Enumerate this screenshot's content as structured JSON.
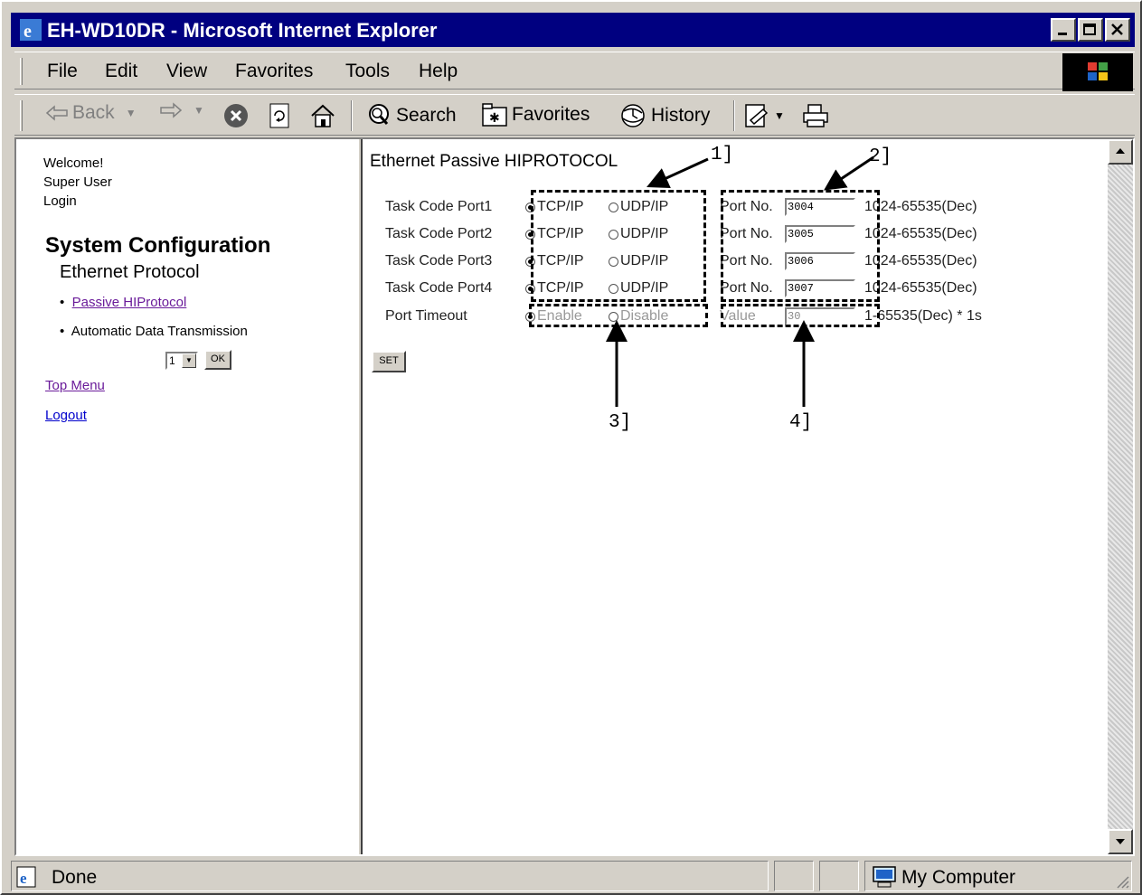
{
  "window": {
    "title": "EH-WD10DR - Microsoft Internet Explorer"
  },
  "menu": {
    "items": [
      "File",
      "Edit",
      "View",
      "Favorites",
      "Tools",
      "Help"
    ]
  },
  "toolbar": {
    "back": "Back",
    "search": "Search",
    "favorites": "Favorites",
    "history": "History"
  },
  "left": {
    "welcome": "Welcome!",
    "user": "Super User",
    "login": "Login",
    "section_title": "System Configuration",
    "subsection": "Ethernet Protocol",
    "link_passive": "Passive HIProtocol",
    "link_auto": "Automatic Data Transmission",
    "select_value": "1",
    "ok_label": "OK",
    "top_menu": "Top Menu",
    "logout": "Logout"
  },
  "main": {
    "title": "Ethernet Passive HIPROTOCOL",
    "rows": [
      {
        "label": "Task Code Port1",
        "opt1": "TCP/IP",
        "opt2": "UDP/IP",
        "port_label": "Port No.",
        "port": "3004",
        "range": "1024-65535(Dec)"
      },
      {
        "label": "Task Code Port2",
        "opt1": "TCP/IP",
        "opt2": "UDP/IP",
        "port_label": "Port No.",
        "port": "3005",
        "range": "1024-65535(Dec)"
      },
      {
        "label": "Task Code Port3",
        "opt1": "TCP/IP",
        "opt2": "UDP/IP",
        "port_label": "Port No.",
        "port": "3006",
        "range": "1024-65535(Dec)"
      },
      {
        "label": "Task Code Port4",
        "opt1": "TCP/IP",
        "opt2": "UDP/IP",
        "port_label": "Port No.",
        "port": "3007",
        "range": "1024-65535(Dec)"
      }
    ],
    "timeout": {
      "label": "Port Timeout",
      "opt1": "Enable",
      "opt2": "Disable",
      "value_label": "Value",
      "value": "30",
      "range": "1-65535(Dec) * 1s"
    },
    "set_label": "SET",
    "callouts": [
      "1]",
      "2]",
      "3]",
      "4]"
    ]
  },
  "status": {
    "text": "Done",
    "zone": "My Computer"
  }
}
